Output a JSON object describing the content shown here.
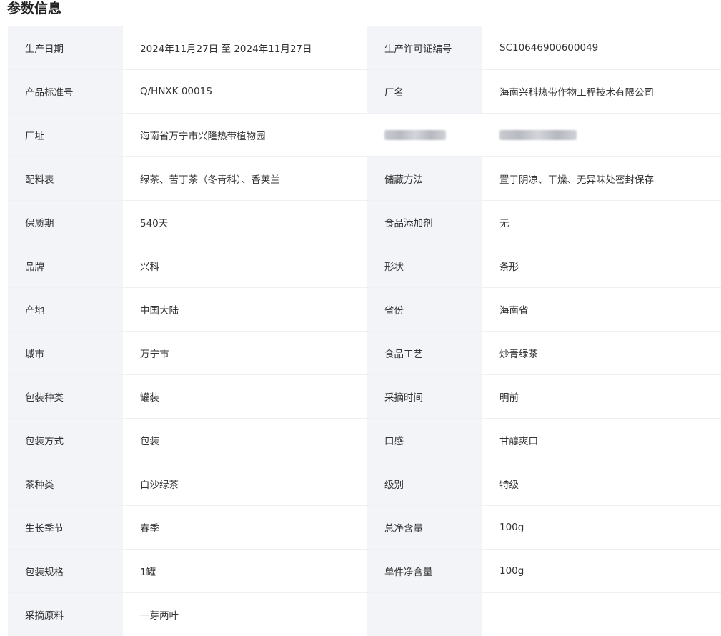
{
  "section": {
    "title": "参数信息"
  },
  "rows": [
    {
      "l1": "生产日期",
      "v1": "2024年11月27日 至 2024年11月27日",
      "l2": "生产许可证编号",
      "v2": "SC10646900600049"
    },
    {
      "l1": "产品标准号",
      "v1": "Q/HNXK 0001S",
      "l2": "厂名",
      "v2": "海南兴科热带作物工程技术有限公司"
    },
    {
      "l1": "厂址",
      "v1": "海南省万宁市兴隆热带植物园",
      "l2": "",
      "v2": ""
    },
    {
      "l1": "配料表",
      "v1": "绿茶、苦丁茶（冬青科）、香荚兰",
      "l2": "储藏方法",
      "v2": "置于阴凉、干燥、无异味处密封保存"
    },
    {
      "l1": "保质期",
      "v1": "540天",
      "l2": "食品添加剂",
      "v2": "无"
    },
    {
      "l1": "品牌",
      "v1": "兴科",
      "l2": "形状",
      "v2": "条形"
    },
    {
      "l1": "产地",
      "v1": "中国大陆",
      "l2": "省份",
      "v2": "海南省"
    },
    {
      "l1": "城市",
      "v1": "万宁市",
      "l2": "食品工艺",
      "v2": "炒青绿茶"
    },
    {
      "l1": "包装种类",
      "v1": "罐装",
      "l2": "采摘时间",
      "v2": "明前"
    },
    {
      "l1": "包装方式",
      "v1": "包装",
      "l2": "口感",
      "v2": "甘醇爽口"
    },
    {
      "l1": "茶种类",
      "v1": "白沙绿茶",
      "l2": "级别",
      "v2": "特级"
    },
    {
      "l1": "生长季节",
      "v1": "春季",
      "l2": "总净含量",
      "v2": "100g"
    },
    {
      "l1": "包装规格",
      "v1": "1罐",
      "l2": "单件净含量",
      "v2": "100g"
    },
    {
      "l1": "采摘原料",
      "v1": "一芽两叶",
      "l2": "",
      "v2": ""
    }
  ]
}
